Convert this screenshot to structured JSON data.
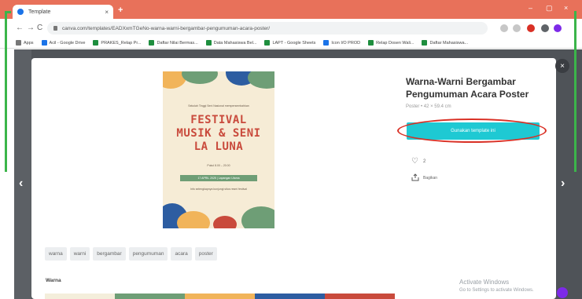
{
  "browser": {
    "tab_title": "Template",
    "tab_close": "×",
    "new_tab": "+",
    "window_controls": [
      "–",
      "▢",
      "×"
    ],
    "url": "canva.com/templates/EADXxmTGeNo-warna-warni-bergambar-pengumuman-acara-poster/",
    "nav": {
      "back": "←",
      "forward": "→",
      "reload": "C"
    },
    "bookmarks": [
      "Apps",
      "Acil - Google Drive",
      "PRAKES_Relap Pr...",
      "Daftar Nilai Bermas...",
      "Data Mahasiswa Bel...",
      "LAPT - Google Sheets",
      "Icon I/O PROD",
      "Relap Dosen Wali...",
      "Daftar Mahasiswa..."
    ]
  },
  "modal": {
    "close": "×",
    "title": "Warna-Warni Bergambar Pengumuman Acara Poster",
    "subtitle": "Poster • 42 × 59.4 cm",
    "cta_label": "Gunakan template ini",
    "like_count": "2",
    "share_label": "Bagikan",
    "prev_arrow": "‹",
    "next_arrow": "›"
  },
  "poster": {
    "top_text": "Sekolah Tinggi Seni Nasional mempersembahkan",
    "title_lines": [
      "FESTIVAL",
      "MUSIK & SENI",
      "LA LUNA"
    ],
    "time_text": "Pukul 8.00 – 20.00",
    "date_text": "17 APRIL 2025 | Lapangan Utama",
    "bottom_text": "Info selengkapnya kunjungi situs resmi festival"
  },
  "tags": [
    "warna",
    "warni",
    "bergambar",
    "pengumuman",
    "acara",
    "poster"
  ],
  "colors_section": {
    "label": "Warna",
    "swatches": [
      "#f4eedb",
      "#6e9e76",
      "#f1b45a",
      "#2d5da1",
      "#c94a3c"
    ]
  },
  "watermark": {
    "line1": "Activate Windows",
    "line2": "Go to Settings to activate Windows."
  },
  "accent_colors": {
    "tabbar": "#e8715a",
    "cta": "#1ec9d3",
    "highlight_ring": "#d93025"
  }
}
